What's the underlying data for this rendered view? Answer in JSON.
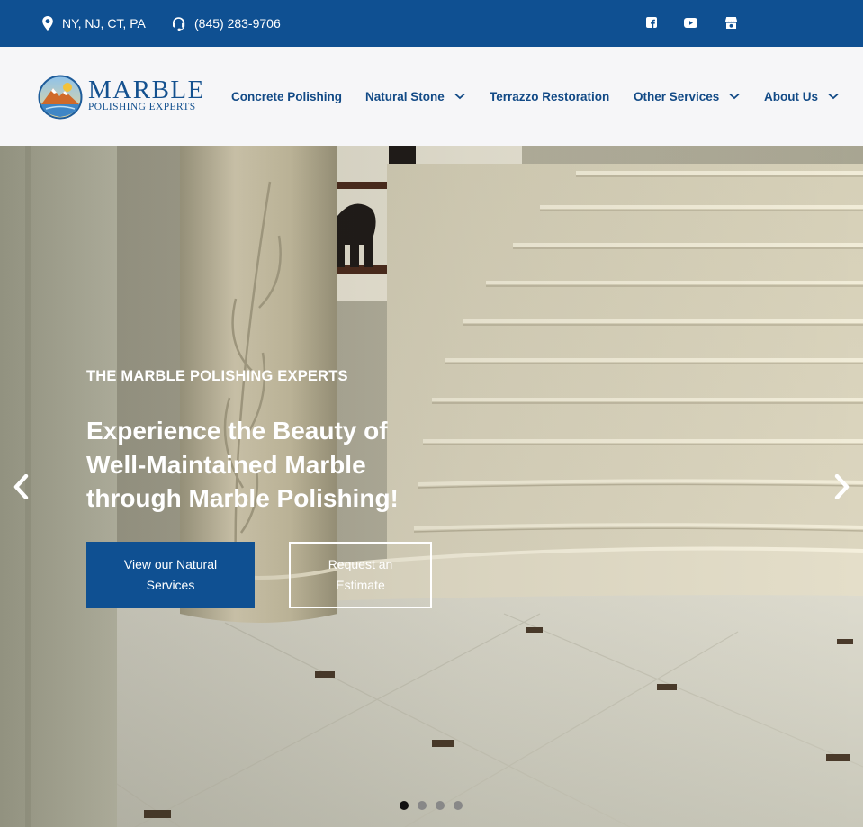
{
  "topbar": {
    "location": "NY, NJ, CT, PA",
    "phone": "(845) 283-9706",
    "location_icon": "map-pin-icon",
    "phone_icon": "headset-icon",
    "social": [
      "facebook-icon",
      "youtube-icon",
      "google-business-icon"
    ],
    "background": "#0f5092"
  },
  "header": {
    "logo": {
      "word": "MARBLE",
      "sub": "POLISHING EXPERTS"
    },
    "nav": [
      {
        "label": "Concrete Polishing",
        "dropdown": false
      },
      {
        "label": "Natural Stone",
        "dropdown": true
      },
      {
        "label": "Terrazzo Restoration",
        "dropdown": false
      },
      {
        "label": "Other Services",
        "dropdown": true
      },
      {
        "label": "About Us",
        "dropdown": true
      }
    ],
    "nav_color": "#124a86"
  },
  "hero": {
    "eyebrow": "THE MARBLE POLISHING EXPERTS",
    "headline": "Experience the Beauty of Well-Maintained Marble through Marble Polishing!",
    "primary_button": "View our Natural Services",
    "secondary_button": "Request an Estimate",
    "slide_count": 4,
    "active_slide": 1,
    "arrows": [
      "chevron-left-icon",
      "chevron-right-icon"
    ]
  }
}
